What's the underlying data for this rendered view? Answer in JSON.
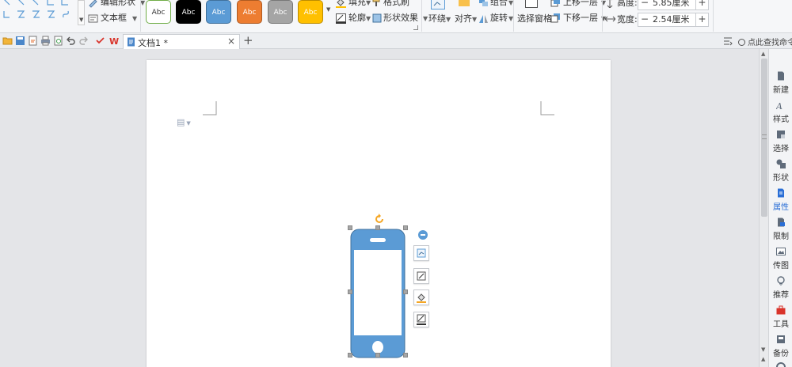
{
  "ribbon": {
    "edit_shape_label": "编辑形状",
    "textbox_label": "文本框",
    "style_samples": [
      {
        "label": "Abc",
        "bg": "#ffffff",
        "fg": "#333333",
        "border": "#70ad47"
      },
      {
        "label": "Abc",
        "bg": "#000000",
        "fg": "#ffffff",
        "border": "#000000"
      },
      {
        "label": "Abc",
        "bg": "#5b9bd5",
        "fg": "#ffffff",
        "border": "#41719c"
      },
      {
        "label": "Abc",
        "bg": "#ed7d31",
        "fg": "#ffffff",
        "border": "#ae5a21"
      },
      {
        "label": "Abc",
        "bg": "#a5a5a5",
        "fg": "#ffffff",
        "border": "#787878"
      },
      {
        "label": "Abc",
        "bg": "#ffc000",
        "fg": "#ffffff",
        "border": "#bc8c00"
      }
    ],
    "fill_label": "填充",
    "format_painter_label": "格式刷",
    "outline_label": "轮廓",
    "shape_effects_label": "形状效果",
    "wrap_label": "环绕",
    "align_label": "对齐",
    "group_label": "组合",
    "rotate_label": "旋转",
    "selection_pane_label": "选择窗格",
    "bring_forward_label": "上移一层",
    "send_backward_label": "下移一层",
    "height_label": "高度:",
    "height_value": "5.85厘米",
    "width_label": "宽度:",
    "width_value": "2.54厘米"
  },
  "tabbar": {
    "doc_tab_label": "文档1 *",
    "close_glyph": "×",
    "new_tab_glyph": "+",
    "search_command_label": "点此查找命令"
  },
  "sidebar": {
    "items": [
      {
        "label": "新建"
      },
      {
        "label": "样式"
      },
      {
        "label": "选择"
      },
      {
        "label": "形状"
      },
      {
        "label": "属性"
      },
      {
        "label": "限制"
      },
      {
        "label": "传图"
      },
      {
        "label": "推荐"
      },
      {
        "label": "工具"
      },
      {
        "label": "备份"
      }
    ]
  },
  "colors": {
    "accent": "#2b6fd6",
    "shape_fill": "#5b9bd5",
    "rotate_handle": "#f5a623",
    "page_bg": "#ffffff",
    "workspace_bg": "#e4e5e8"
  }
}
